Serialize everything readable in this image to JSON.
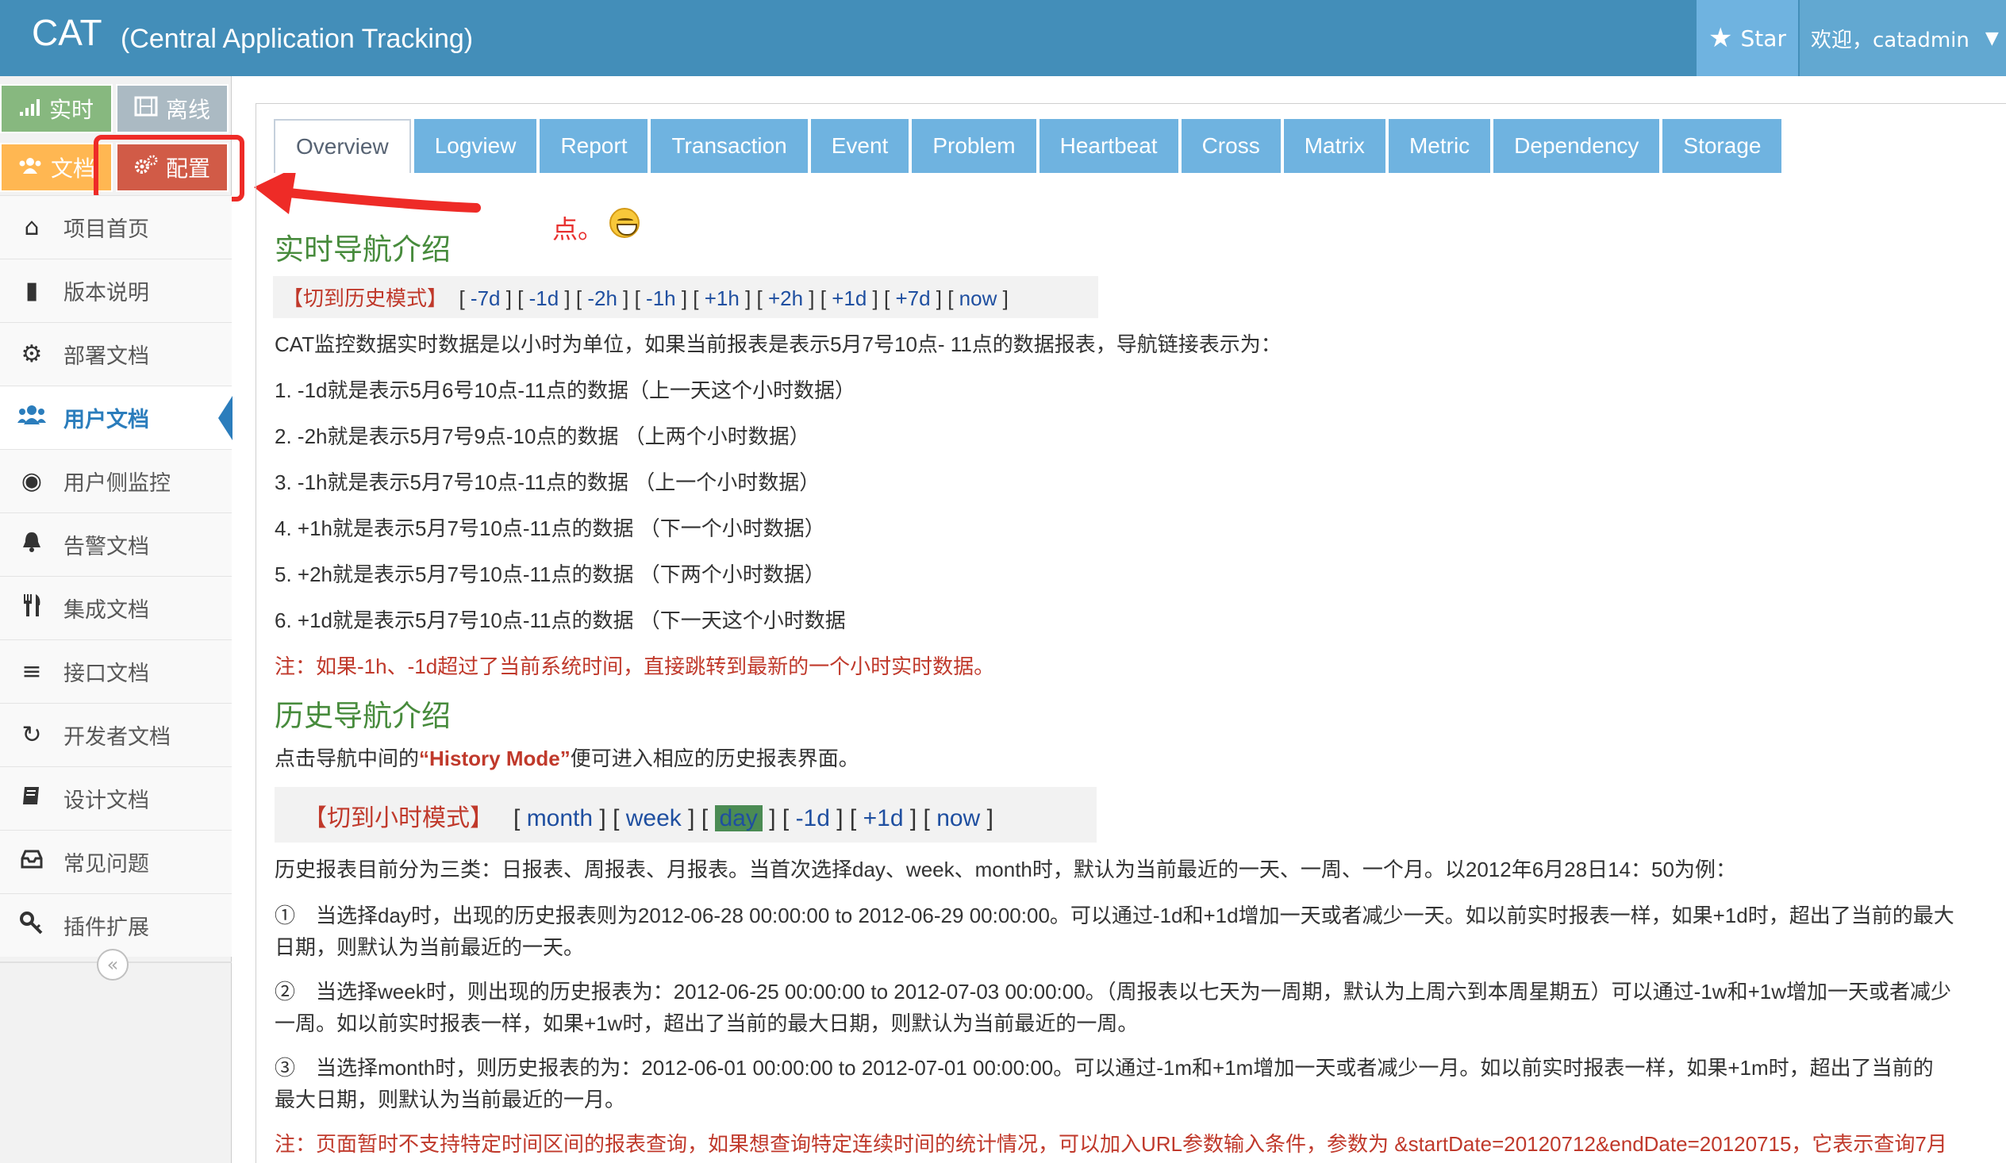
{
  "header": {
    "brand": "CAT",
    "subtitle": "(Central Application Tracking)",
    "star_label": "Star",
    "user_label": "欢迎，catadmin",
    "colors": {
      "bar": "#438eb9",
      "star": "#6fb3e0",
      "user": "#62a8d1"
    }
  },
  "sidebar": {
    "shortcuts": [
      {
        "label": "实时",
        "icon": "signal-icon"
      },
      {
        "label": "离线",
        "icon": "film-icon"
      },
      {
        "label": "文档",
        "icon": "users-icon"
      },
      {
        "label": "配置",
        "icon": "cogs-icon"
      }
    ],
    "items": [
      {
        "label": "项目首页",
        "icon": "home-icon"
      },
      {
        "label": "版本说明",
        "icon": "book-icon"
      },
      {
        "label": "部署文档",
        "icon": "cogs-icon"
      },
      {
        "label": "用户文档",
        "icon": "users-icon",
        "active": true
      },
      {
        "label": "用户侧监控",
        "icon": "globe-icon"
      },
      {
        "label": "告警文档",
        "icon": "bell-icon"
      },
      {
        "label": "集成文档",
        "icon": "cutlery-icon"
      },
      {
        "label": "接口文档",
        "icon": "list-icon"
      },
      {
        "label": "开发者文档",
        "icon": "refresh-icon"
      },
      {
        "label": "设计文档",
        "icon": "book-icon"
      },
      {
        "label": "常见问题",
        "icon": "inbox-icon"
      },
      {
        "label": "插件扩展",
        "icon": "key-icon"
      }
    ],
    "collapse_glyph": "«"
  },
  "tabs": [
    "Overview",
    "Logview",
    "Report",
    "Transaction",
    "Event",
    "Problem",
    "Heartbeat",
    "Cross",
    "Matrix",
    "Metric",
    "Dependency",
    "Storage"
  ],
  "annotation": {
    "text": "点。"
  },
  "doc": {
    "realtime_title": "实时导航介绍",
    "realtime_nav": {
      "mode_switch": "【切到历史模式】",
      "links": [
        "-7d",
        "-1d",
        "-2h",
        "-1h",
        "+1h",
        "+2h",
        "+1d",
        "+7d",
        "now"
      ]
    },
    "realtime_intro": "CAT监控数据实时数据是以小时为单位，如果当前报表是表示5月7号10点- 11点的数据报表，导航链接表示为：",
    "realtime_items": [
      "1. -1d就是表示5月6号10点-11点的数据（上一天这个小时数据）",
      "2. -2h就是表示5月7号9点-10点的数据 （上两个小时数据）",
      "3. -1h就是表示5月7号10点-11点的数据 （上一个小时数据）",
      "4. +1h就是表示5月7号10点-11点的数据 （下一个小时数据）",
      "5. +2h就是表示5月7号10点-11点的数据 （下两个小时数据）",
      "6. +1d就是表示5月7号10点-11点的数据 （下一天这个小时数据"
    ],
    "realtime_note": "注：如果-1h、-1d超过了当前系统时间，直接跳转到最新的一个小时实时数据。",
    "history_title": "历史导航介绍",
    "history_intro_pre": "点击导航中间的",
    "history_intro_key": "“History Mode”",
    "history_intro_post": "便可进入相应的历史报表界面。",
    "history_nav": {
      "mode_switch": "【切到小时模式】",
      "links": [
        "month",
        "week",
        "day",
        "-1d",
        "+1d",
        "now"
      ]
    },
    "history_desc": "历史报表目前分为三类：日报表、周报表、月报表。当首次选择day、week、month时，默认为当前最近的一天、一周、一个月。以2012年6月28日14：50为例：",
    "history_items": [
      {
        "line1": "①　当选择day时，出现的历史报表则为2012-06-28 00:00:00 to 2012-06-29 00:00:00。可以通过-1d和+1d增加一天或者减少一天。如以前实时报表一样，如果+1d时，超出了当前的最大",
        "line2": "日期，则默认为当前最近的一天。"
      },
      {
        "line1": "②　当选择week时，则出现的历史报表为：2012-06-25 00:00:00 to 2012-07-03 00:00:00。（周报表以七天为一周期，默认为上周六到本周星期五）可以通过-1w和+1w增加一天或者减少",
        "line2": "一周。如以前实时报表一样，如果+1w时，超出了当前的最大日期，则默认为当前最近的一周。"
      },
      {
        "line1": "③　当选择month时，则历史报表的为：2012-06-01 00:00:00 to 2012-07-01 00:00:00。可以通过-1m和+1m增加一天或者减少一月。如以前实时报表一样，如果+1m时，超出了当前的",
        "line2": "最大日期，则默认为当前最近的一月。"
      }
    ],
    "history_note": "注：页面暂时不支持特定时间区间的报表查询，如果想查询特定连续时间的统计情况，可以加入URL参数输入条件，参数为 &startDate=20120712&endDate=20120715，它表示查询7月"
  }
}
